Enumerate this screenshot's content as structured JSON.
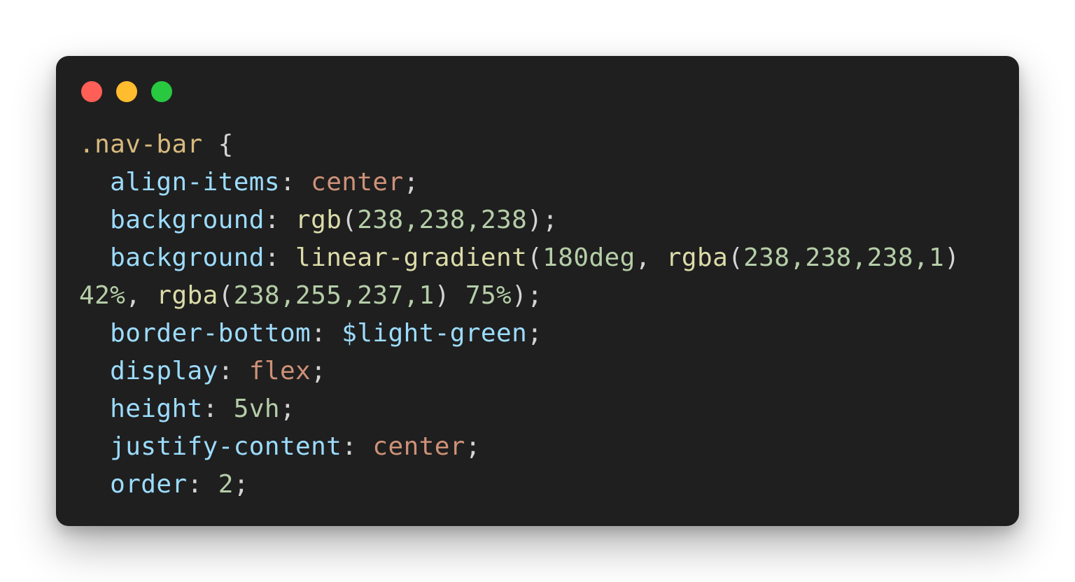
{
  "window": {
    "controls": [
      "close",
      "minimize",
      "maximize"
    ],
    "colors": {
      "background": "#1f1f1f",
      "close": "#ff5f57",
      "minimize": "#febc2e",
      "maximize": "#28c840"
    }
  },
  "code": {
    "language": "css",
    "lines": [
      [
        {
          "t": ".nav-bar",
          "c": "sel"
        },
        {
          "t": " {",
          "c": "punc"
        }
      ],
      [
        {
          "t": "  align-items",
          "c": "prop"
        },
        {
          "t": ": ",
          "c": "punc"
        },
        {
          "t": "center",
          "c": "kw"
        },
        {
          "t": ";",
          "c": "punc"
        }
      ],
      [
        {
          "t": "  background",
          "c": "prop"
        },
        {
          "t": ": ",
          "c": "punc"
        },
        {
          "t": "rgb",
          "c": "fn"
        },
        {
          "t": "(",
          "c": "punc"
        },
        {
          "t": "238,238,238",
          "c": "num"
        },
        {
          "t": ");",
          "c": "punc"
        }
      ],
      [
        {
          "t": "  background",
          "c": "prop"
        },
        {
          "t": ": ",
          "c": "punc"
        },
        {
          "t": "linear-gradient",
          "c": "fn"
        },
        {
          "t": "(",
          "c": "punc"
        },
        {
          "t": "180deg",
          "c": "num"
        },
        {
          "t": ", ",
          "c": "punc"
        },
        {
          "t": "rgba",
          "c": "fn"
        },
        {
          "t": "(",
          "c": "punc"
        },
        {
          "t": "238,238,238,1",
          "c": "num"
        },
        {
          "t": ")",
          "c": "punc"
        }
      ],
      [
        {
          "t": "42%",
          "c": "num"
        },
        {
          "t": ", ",
          "c": "punc"
        },
        {
          "t": "rgba",
          "c": "fn"
        },
        {
          "t": "(",
          "c": "punc"
        },
        {
          "t": "238,255,237,1",
          "c": "num"
        },
        {
          "t": ") ",
          "c": "punc"
        },
        {
          "t": "75%",
          "c": "num"
        },
        {
          "t": ");",
          "c": "punc"
        }
      ],
      [
        {
          "t": "  border-bottom",
          "c": "prop"
        },
        {
          "t": ": ",
          "c": "punc"
        },
        {
          "t": "$light-green",
          "c": "prop"
        },
        {
          "t": ";",
          "c": "punc"
        }
      ],
      [
        {
          "t": "  display",
          "c": "prop"
        },
        {
          "t": ": ",
          "c": "punc"
        },
        {
          "t": "flex",
          "c": "kw"
        },
        {
          "t": ";",
          "c": "punc"
        }
      ],
      [
        {
          "t": "  height",
          "c": "prop"
        },
        {
          "t": ": ",
          "c": "punc"
        },
        {
          "t": "5vh",
          "c": "num"
        },
        {
          "t": ";",
          "c": "punc"
        }
      ],
      [
        {
          "t": "  justify-content",
          "c": "prop"
        },
        {
          "t": ": ",
          "c": "punc"
        },
        {
          "t": "center",
          "c": "kw"
        },
        {
          "t": ";",
          "c": "punc"
        }
      ],
      [
        {
          "t": "  order",
          "c": "prop"
        },
        {
          "t": ": ",
          "c": "punc"
        },
        {
          "t": "2",
          "c": "num"
        },
        {
          "t": ";",
          "c": "punc"
        }
      ]
    ],
    "syntax_colors": {
      "sel": "#d7ba7d",
      "prop": "#9cdcfe",
      "kw": "#ce9178",
      "fn": "#dcdcaa",
      "num": "#b5cea8",
      "punc": "#d4d4d4"
    }
  }
}
